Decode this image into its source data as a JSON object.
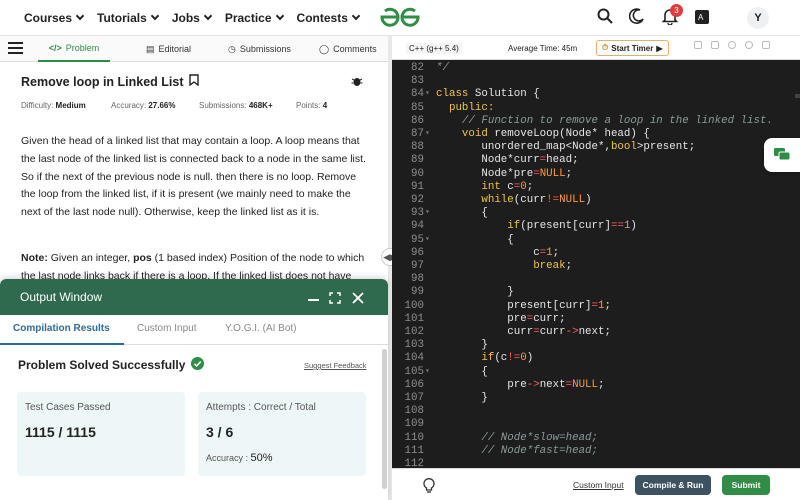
{
  "nav": {
    "items": [
      "Courses",
      "Tutorials",
      "Jobs",
      "Practice",
      "Contests"
    ],
    "notification_count": "3",
    "avatar_initial": "Y"
  },
  "problem_tabs": [
    {
      "label": "Problem",
      "icon": "code-icon"
    },
    {
      "label": "Editorial",
      "icon": "document-icon"
    },
    {
      "label": "Submissions",
      "icon": "clock-icon"
    },
    {
      "label": "Comments",
      "icon": "comment-icon"
    }
  ],
  "problem": {
    "title": "Remove loop in Linked List",
    "difficulty_label": "Difficulty:",
    "difficulty": "Medium",
    "accuracy_label": "Accuracy:",
    "accuracy": "27.66%",
    "submissions_label": "Submissions:",
    "submissions": "468K+",
    "points_label": "Points:",
    "points": "4",
    "description": "Given the head of a linked list that may contain a loop.  A loop means that the last node of the linked list is connected back to a node in the same list.  So if the next of the previous node is null. then there is no loop.  Remove the loop from the linked list, if it is present (we mainly need to make the next of the last node null). Otherwise, keep the linked list as it is.",
    "note_label": "Note:",
    "note_text_1": " Given an integer, ",
    "note_bold": "pos",
    "note_text_2": " (1 based index)  Position of the node to which the last node links back if there is a loop. If the linked list does not have"
  },
  "output": {
    "title": "Output Window",
    "tabs": [
      "Compilation Results",
      "Custom Input",
      "Y.O.G.I. (AI Bot)"
    ],
    "status": "Problem Solved Successfully",
    "feedback": "Suggest Feedback",
    "tests_label": "Test Cases Passed",
    "tests_value": "1115 / 1115",
    "attempts_label": "Attempts : Correct / Total",
    "attempts_value": "3 / 6",
    "accuracy_label": "Accuracy :",
    "accuracy_value": "50%"
  },
  "editor": {
    "language": "C++ (g++ 5.4)",
    "avg_time": "Average Time: 45m",
    "timer_label": "Start Timer",
    "custom_input": "Custom Input",
    "compile_label": "Compile & Run",
    "submit_label": "Submit",
    "code": [
      {
        "n": "82",
        "parts": [
          {
            "t": "*/",
            "c": "cm"
          }
        ]
      },
      {
        "n": "83",
        "parts": []
      },
      {
        "n": "84",
        "fold": true,
        "parts": [
          {
            "t": "class ",
            "c": "kw"
          },
          {
            "t": "Solution {",
            "c": ""
          }
        ]
      },
      {
        "n": "85",
        "parts": [
          {
            "t": "  public:",
            "c": "kw"
          }
        ]
      },
      {
        "n": "86",
        "parts": [
          {
            "t": "    // Function to remove a loop in the linked list.",
            "c": "cm"
          }
        ]
      },
      {
        "n": "87",
        "fold": true,
        "parts": [
          {
            "t": "    void ",
            "c": "kw"
          },
          {
            "t": "removeLoop(Node* head) {",
            "c": ""
          }
        ]
      },
      {
        "n": "88",
        "parts": [
          {
            "t": "       unordered_map<Node*,",
            "c": ""
          },
          {
            "t": "bool",
            "c": "kw"
          },
          {
            "t": ">present;",
            "c": ""
          }
        ]
      },
      {
        "n": "89",
        "parts": [
          {
            "t": "       Node*curr",
            "c": ""
          },
          {
            "t": "=",
            "c": "op"
          },
          {
            "t": "head;",
            "c": ""
          }
        ]
      },
      {
        "n": "90",
        "parts": [
          {
            "t": "       Node*pre",
            "c": ""
          },
          {
            "t": "=",
            "c": "op"
          },
          {
            "t": "NULL",
            "c": "num"
          },
          {
            "t": ";",
            "c": ""
          }
        ]
      },
      {
        "n": "91",
        "parts": [
          {
            "t": "       ",
            "c": ""
          },
          {
            "t": "int ",
            "c": "kw"
          },
          {
            "t": "c",
            "c": ""
          },
          {
            "t": "=",
            "c": "op"
          },
          {
            "t": "0",
            "c": "num"
          },
          {
            "t": ";",
            "c": ""
          }
        ]
      },
      {
        "n": "92",
        "parts": [
          {
            "t": "       ",
            "c": ""
          },
          {
            "t": "while",
            "c": "kw"
          },
          {
            "t": "(curr",
            "c": ""
          },
          {
            "t": "!=",
            "c": "op"
          },
          {
            "t": "NULL",
            "c": "num"
          },
          {
            "t": ")",
            "c": ""
          }
        ]
      },
      {
        "n": "93",
        "fold": true,
        "parts": [
          {
            "t": "       {",
            "c": ""
          }
        ]
      },
      {
        "n": "94",
        "parts": [
          {
            "t": "           ",
            "c": ""
          },
          {
            "t": "if",
            "c": "kw"
          },
          {
            "t": "(present[curr]",
            "c": ""
          },
          {
            "t": "==",
            "c": "op"
          },
          {
            "t": "1",
            "c": "num"
          },
          {
            "t": ")",
            "c": ""
          }
        ]
      },
      {
        "n": "95",
        "fold": true,
        "parts": [
          {
            "t": "           {",
            "c": ""
          }
        ]
      },
      {
        "n": "96",
        "parts": [
          {
            "t": "               c",
            "c": ""
          },
          {
            "t": "=",
            "c": "op"
          },
          {
            "t": "1",
            "c": "num"
          },
          {
            "t": ";",
            "c": ""
          }
        ]
      },
      {
        "n": "97",
        "parts": [
          {
            "t": "               ",
            "c": ""
          },
          {
            "t": "break",
            "c": "kw"
          },
          {
            "t": ";",
            "c": ""
          }
        ]
      },
      {
        "n": "98",
        "parts": []
      },
      {
        "n": "99",
        "parts": [
          {
            "t": "           }",
            "c": ""
          }
        ]
      },
      {
        "n": "100",
        "parts": [
          {
            "t": "           present[curr]",
            "c": ""
          },
          {
            "t": "=",
            "c": "op"
          },
          {
            "t": "1",
            "c": "num"
          },
          {
            "t": ";",
            "c": ""
          }
        ]
      },
      {
        "n": "101",
        "parts": [
          {
            "t": "           pre",
            "c": ""
          },
          {
            "t": "=",
            "c": "op"
          },
          {
            "t": "curr;",
            "c": ""
          }
        ]
      },
      {
        "n": "102",
        "parts": [
          {
            "t": "           curr",
            "c": ""
          },
          {
            "t": "=",
            "c": "op"
          },
          {
            "t": "curr",
            "c": ""
          },
          {
            "t": "->",
            "c": "op"
          },
          {
            "t": "next;",
            "c": ""
          }
        ]
      },
      {
        "n": "103",
        "parts": [
          {
            "t": "       }",
            "c": ""
          }
        ]
      },
      {
        "n": "104",
        "parts": [
          {
            "t": "       ",
            "c": ""
          },
          {
            "t": "if",
            "c": "kw"
          },
          {
            "t": "(c",
            "c": ""
          },
          {
            "t": "!=",
            "c": "op"
          },
          {
            "t": "0",
            "c": "num"
          },
          {
            "t": ")",
            "c": ""
          }
        ]
      },
      {
        "n": "105",
        "fold": true,
        "parts": [
          {
            "t": "       {",
            "c": ""
          }
        ]
      },
      {
        "n": "106",
        "parts": [
          {
            "t": "           pre",
            "c": ""
          },
          {
            "t": "->",
            "c": "op"
          },
          {
            "t": "next",
            "c": ""
          },
          {
            "t": "=",
            "c": "op"
          },
          {
            "t": "NULL",
            "c": "num"
          },
          {
            "t": ";",
            "c": ""
          }
        ]
      },
      {
        "n": "107",
        "parts": [
          {
            "t": "       }",
            "c": ""
          }
        ]
      },
      {
        "n": "108",
        "parts": []
      },
      {
        "n": "109",
        "parts": []
      },
      {
        "n": "110",
        "parts": [
          {
            "t": "       // Node*slow=head;",
            "c": "cm"
          }
        ]
      },
      {
        "n": "111",
        "parts": [
          {
            "t": "       // Node*fast=head;",
            "c": "cm"
          }
        ]
      },
      {
        "n": "112",
        "parts": []
      }
    ]
  },
  "colors": {
    "brand_green": "#2f8d46",
    "output_header": "#2f6a4f",
    "editor_bg": "#1d1d1d"
  }
}
